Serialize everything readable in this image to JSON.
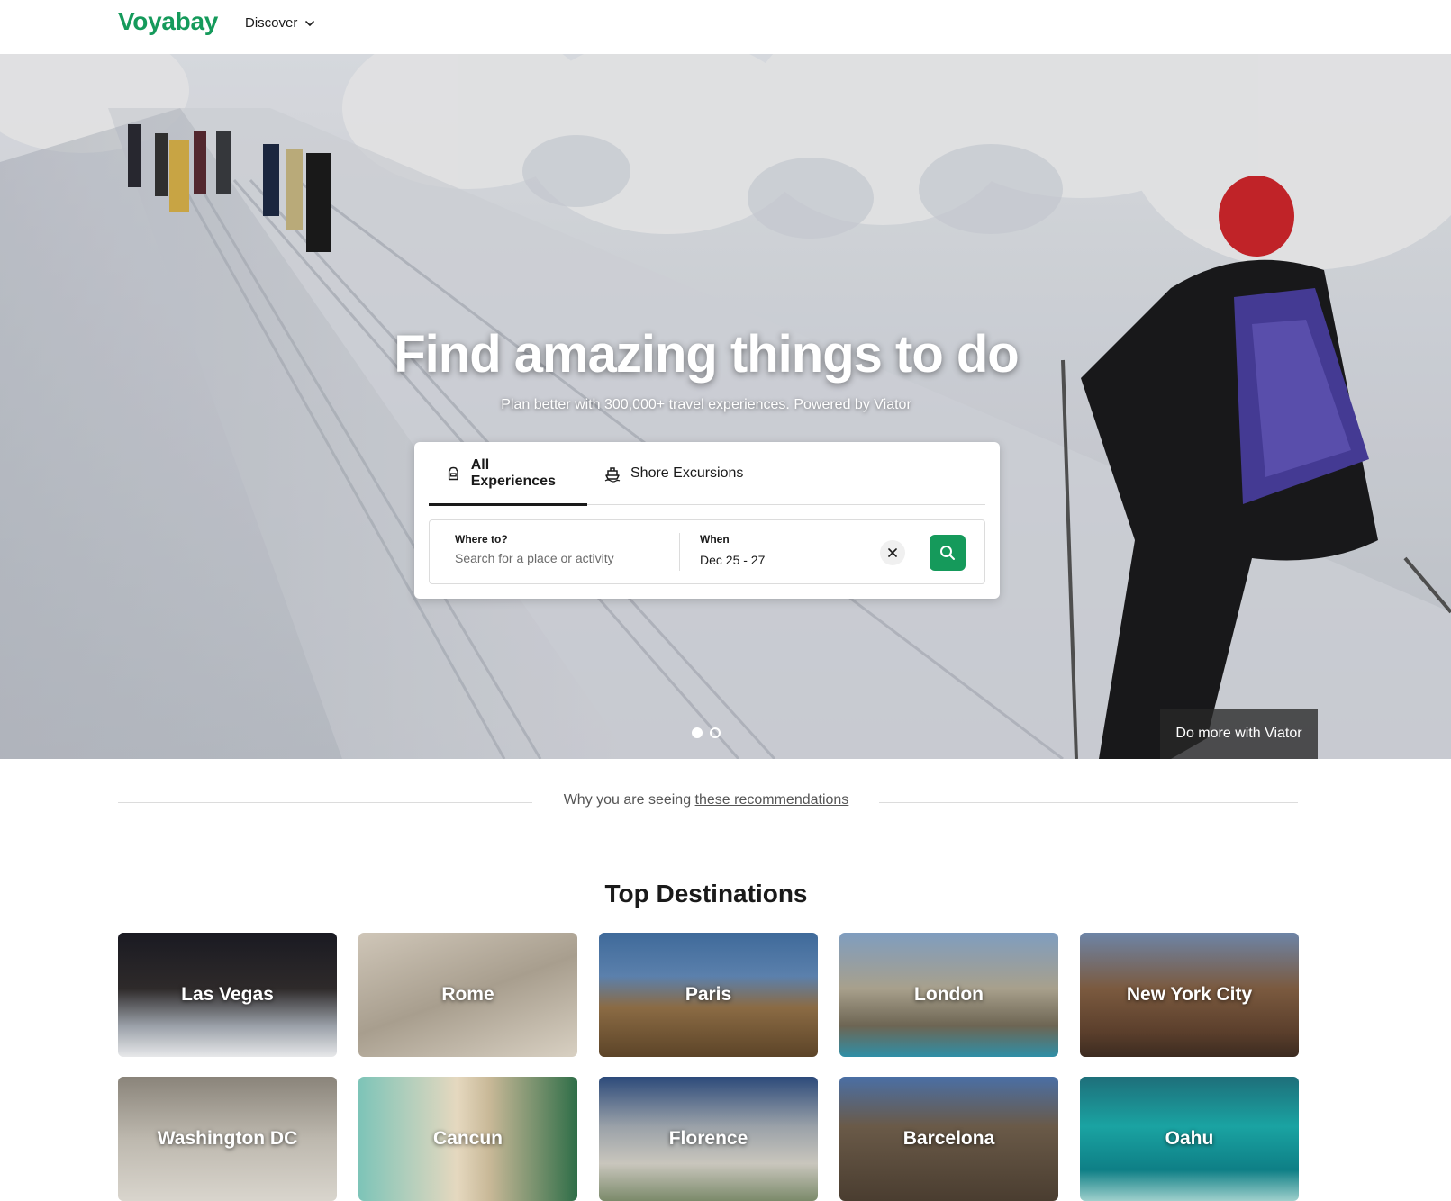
{
  "header": {
    "logo": "Voyabay",
    "discover_label": "Discover"
  },
  "hero": {
    "title": "Find amazing things to do",
    "subtitle": "Plan better with 300,000+ travel experiences. Powered by Viator",
    "do_more_label": "Do more with Viator",
    "slides_total": 2,
    "slide_active": 1
  },
  "search": {
    "tabs": [
      {
        "label": "All Experiences",
        "icon": "backpack-icon",
        "active": true
      },
      {
        "label": "Shore Excursions",
        "icon": "cruise-ship-icon",
        "active": false
      }
    ],
    "where_label": "Where to?",
    "where_placeholder": "Search for a place or activity",
    "when_label": "When",
    "when_value": "Dec 25 - 27",
    "clear_icon": "close-icon",
    "search_icon": "search-icon"
  },
  "why": {
    "prefix": "Why you are seeing ",
    "link": "these recommendations"
  },
  "destinations": {
    "title": "Top Destinations",
    "items": [
      {
        "name": "Las Vegas"
      },
      {
        "name": "Rome"
      },
      {
        "name": "Paris"
      },
      {
        "name": "London"
      },
      {
        "name": "New York City"
      },
      {
        "name": "Washington DC"
      },
      {
        "name": "Cancun"
      },
      {
        "name": "Florence"
      },
      {
        "name": "Barcelona"
      },
      {
        "name": "Oahu"
      }
    ]
  },
  "colors": {
    "brand": "#159a5b"
  }
}
